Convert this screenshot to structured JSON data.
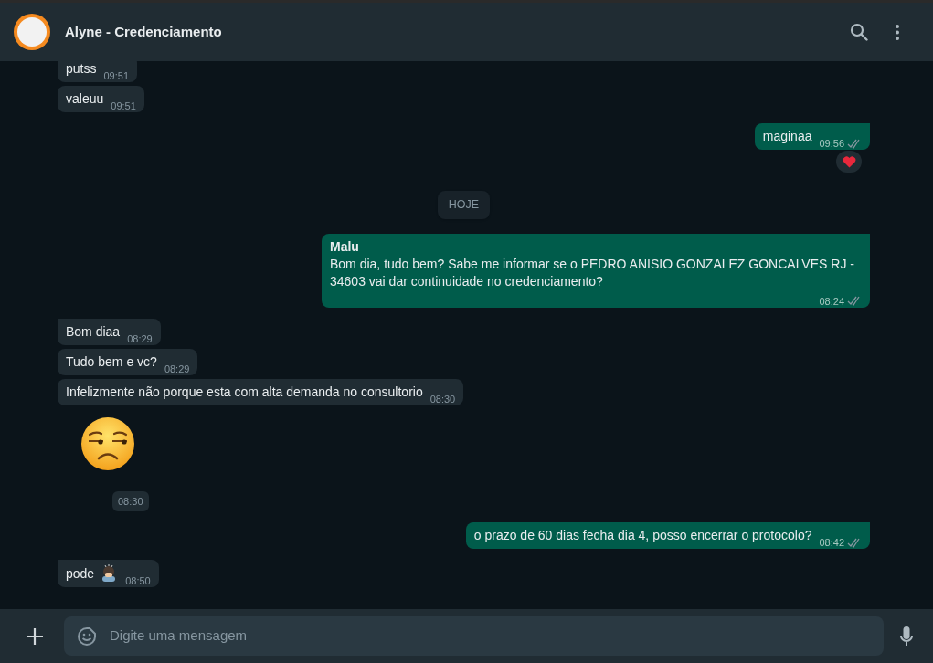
{
  "chat": {
    "title": "Alyne - Credenciamento"
  },
  "messages": [
    {
      "kind": "in",
      "text": "putss",
      "time": "09:51"
    },
    {
      "kind": "in",
      "text": "valeuu",
      "time": "09:51",
      "tail": false
    },
    {
      "kind": "out",
      "text": "maginaa",
      "time": "09:56",
      "tail": true,
      "double_check": true,
      "heart_reaction": true
    },
    {
      "kind": "date",
      "text": "HOJE"
    },
    {
      "kind": "out",
      "sender": "Malu",
      "text": "Bom dia, tudo bem? Sabe me informar se o PEDRO ANISIO GONZALEZ GONCALVES RJ - 34603 vai dar continuidade no credenciamento?",
      "time": "08:24",
      "tail": true,
      "double_check": true
    },
    {
      "kind": "in",
      "text": "Bom diaa",
      "time": "08:29",
      "tail": true
    },
    {
      "kind": "in",
      "text": "Tudo bem e vc?",
      "time": "08:29",
      "tail": false
    },
    {
      "kind": "in",
      "text": "Infelizmente não porque esta com alta demanda no consultorio",
      "time": "08:30",
      "tail": false
    },
    {
      "kind": "sticker",
      "time": "08:30"
    },
    {
      "kind": "out",
      "text": "o prazo de 60 dias fecha dia 4, posso encerrar o protocolo?",
      "time": "08:42",
      "tail": true,
      "double_check": true
    },
    {
      "kind": "in",
      "text": "pode",
      "trailing_emoji": true,
      "time": "08:50",
      "tail": true
    }
  ],
  "composer": {
    "placeholder": "Digite uma mensagem"
  }
}
